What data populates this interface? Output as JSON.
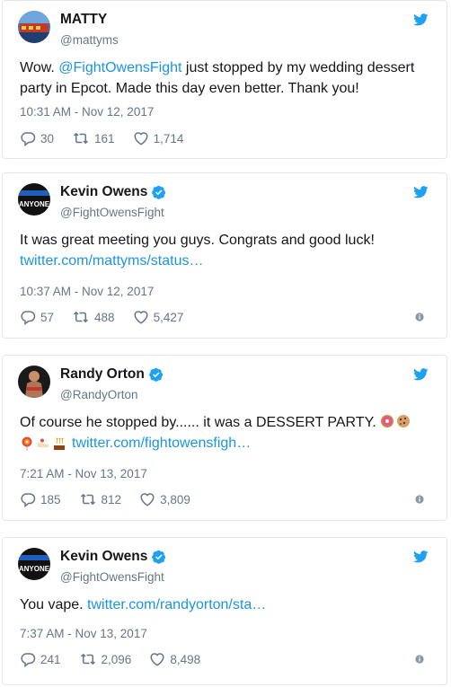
{
  "tweets": [
    {
      "name": "MATTY",
      "handle": "@mattyms",
      "verified": false,
      "text_pre": "Wow. ",
      "mention": "@FightOwensFight",
      "text_post": " just stopped by my wedding dessert party in Epcot. Made this day even better. Thank you!",
      "timestamp": "10:31 AM - Nov 12, 2017",
      "replies": "30",
      "retweets": "161",
      "likes": "1,714"
    },
    {
      "name": "Kevin Owens",
      "handle": "@FightOwensFight",
      "verified": true,
      "avatar_text": "ANYONE",
      "text": "It was great meeting you guys. Congrats and good luck!",
      "link": "twitter.com/mattyms/status…",
      "timestamp": "10:37 AM - Nov 12, 2017",
      "replies": "57",
      "retweets": "488",
      "likes": "5,427"
    },
    {
      "name": "Randy Orton",
      "handle": "@RandyOrton",
      "verified": true,
      "text": "Of course he stopped by...... it was a DESSERT PARTY.",
      "emojis_line1": [
        "doughnut",
        "cookie"
      ],
      "emojis_line2": [
        "lollipop",
        "shortcake",
        "birthday-cake"
      ],
      "link": "twitter.com/fightowensfigh…",
      "timestamp": "7:21 AM - Nov 13, 2017",
      "replies": "185",
      "retweets": "812",
      "likes": "3,809"
    },
    {
      "name": "Kevin Owens",
      "handle": "@FightOwensFight",
      "verified": true,
      "avatar_text": "ANYONE",
      "text": "You vape. ",
      "link": "twitter.com/randyorton/sta…",
      "timestamp": "7:37 AM - Nov 13, 2017",
      "replies": "241",
      "retweets": "2,096",
      "likes": "8,498"
    }
  ],
  "colors": {
    "twitter_blue": "#1da1f2",
    "link_blue": "#1b95e0",
    "gray": "#657786",
    "border": "#e1e8ed"
  }
}
